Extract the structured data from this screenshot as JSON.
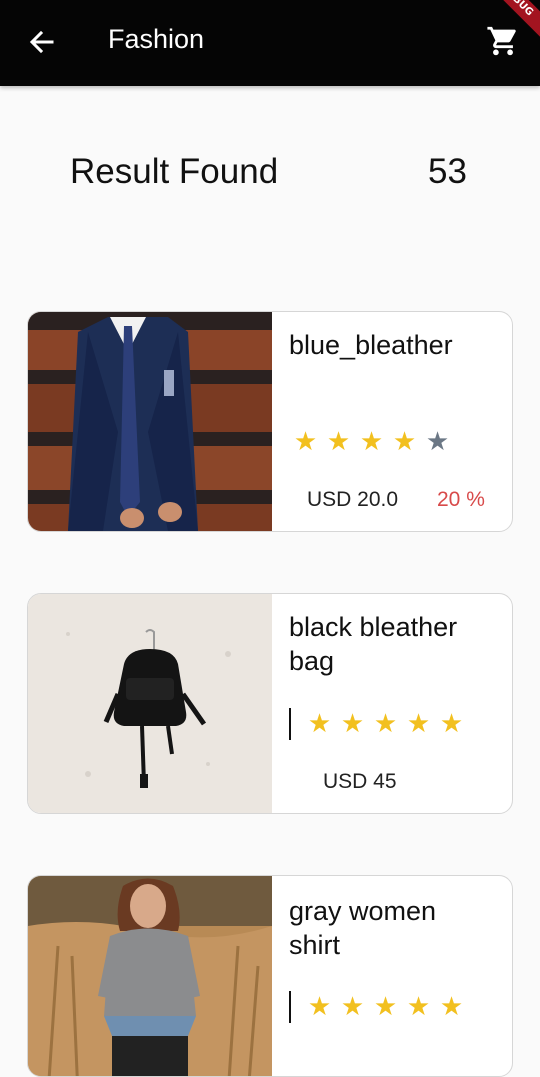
{
  "appbar": {
    "title": "Fashion",
    "back_icon": "arrow-left-icon",
    "cart_icon": "shopping-cart-icon",
    "debug_banner": "DEBUG"
  },
  "results": {
    "label": "Result Found",
    "count": "53"
  },
  "colors": {
    "star_filled": "#f2c01f",
    "star_empty": "#6b7785",
    "discount": "#d84a4a",
    "appbar": "#050505"
  },
  "products": [
    {
      "name": "blue_bleather",
      "rating": 4,
      "rating_max": 5,
      "price": "USD 20.0",
      "discount": "20 %",
      "image": "man-in-blue-suit-photo"
    },
    {
      "name": "black bleather bag",
      "rating": 5,
      "rating_max": 5,
      "price": "USD 45",
      "image": "black-backpack-on-wall-photo"
    },
    {
      "name": "gray women shirt",
      "rating": 5,
      "rating_max": 5,
      "image": "woman-in-gray-shirt-field-photo"
    }
  ]
}
